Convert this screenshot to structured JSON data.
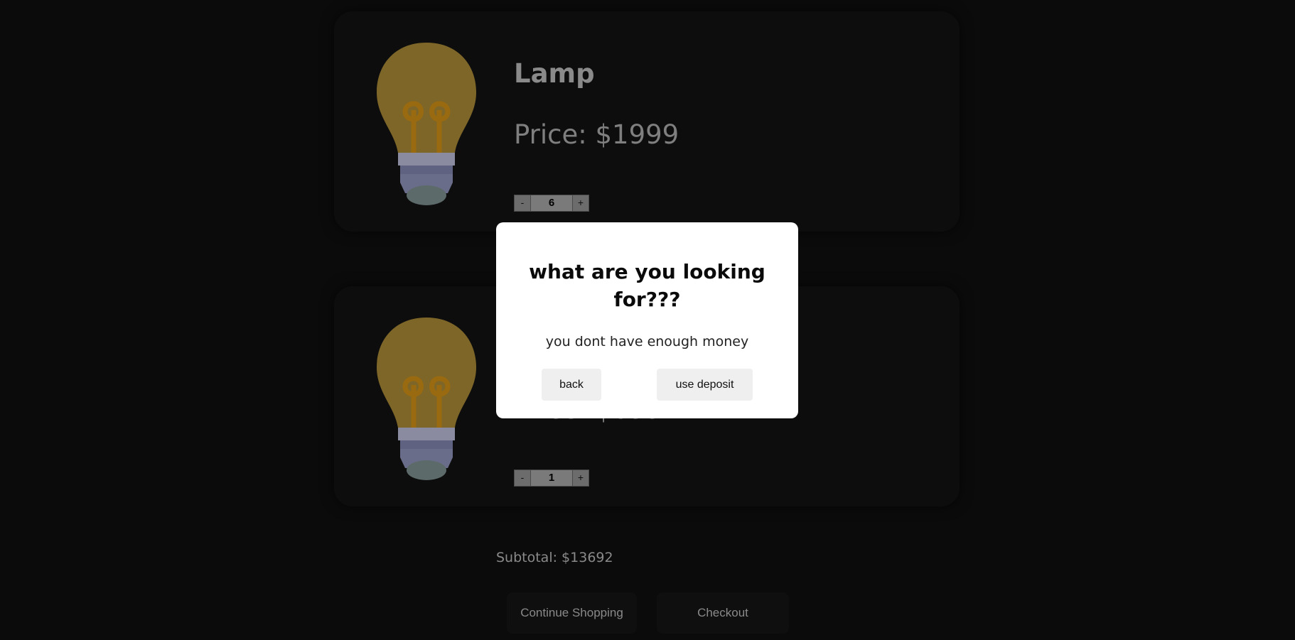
{
  "cart": {
    "items": [
      {
        "name": "Lamp",
        "price_text": "Price: $1999",
        "quantity": "6",
        "decrement_label": "-",
        "increment_label": "+",
        "image_icon": "light-bulb-icon"
      },
      {
        "name": "",
        "price_text": "Price: $699",
        "quantity": "1",
        "decrement_label": "-",
        "increment_label": "+",
        "image_icon": "light-bulb-icon"
      }
    ],
    "subtotal_text": "Subtotal: $13692",
    "continue_label": "Continue Shopping",
    "checkout_label": "Checkout"
  },
  "modal": {
    "title_line1": "what are you looking",
    "title_line2": "for???",
    "message": "you dont have enough money",
    "back_label": "back",
    "deposit_label": "use deposit"
  },
  "colors": {
    "overlay_background": "#0b0b0b",
    "modal_background": "#ffffff",
    "bulb_glass": "#7d6628",
    "bulb_filament": "#9a6a10",
    "bulb_base": "#6a6d8a"
  }
}
